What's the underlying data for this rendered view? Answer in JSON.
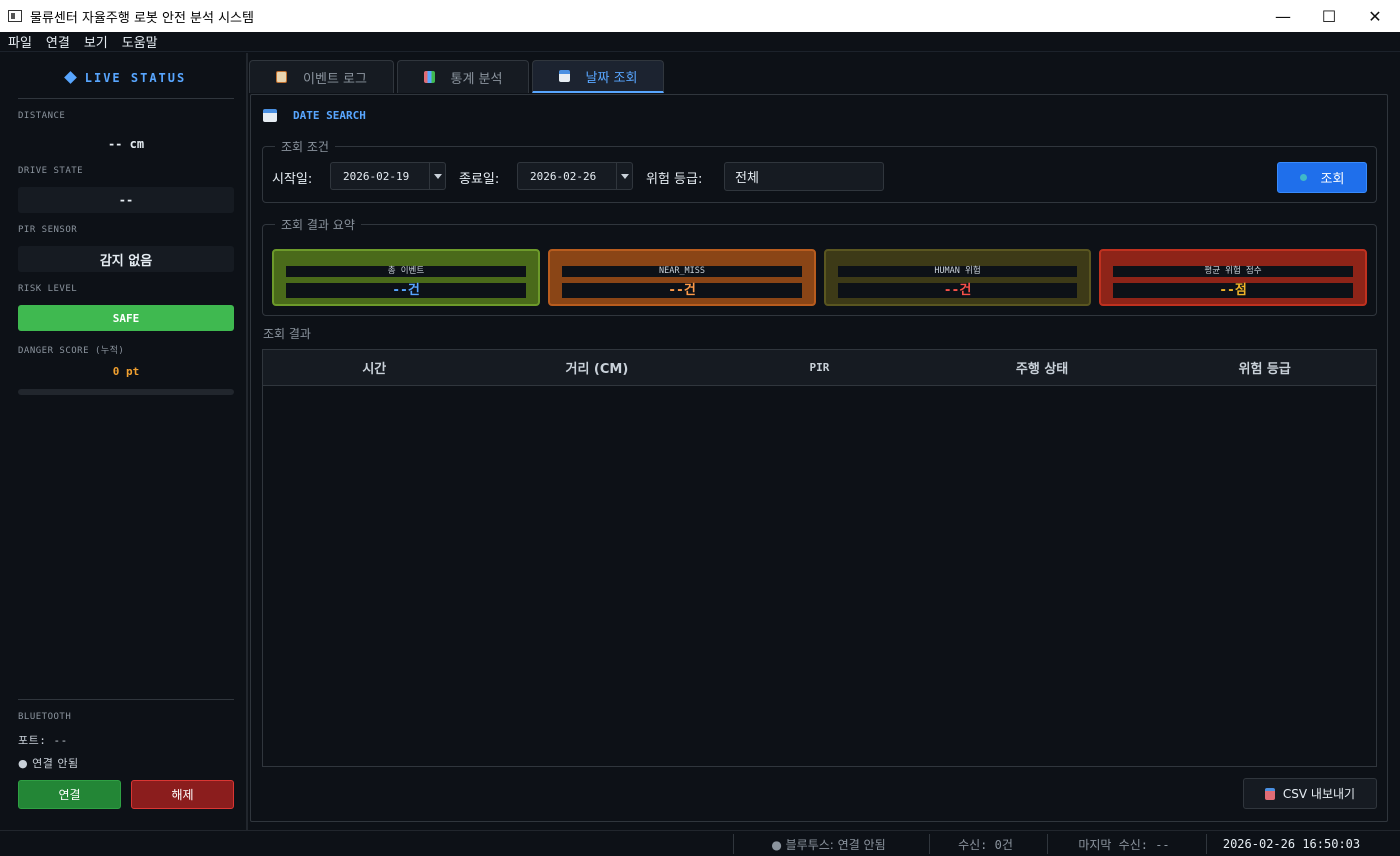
{
  "window": {
    "title": "물류센터 자율주행 로봇 안전 분석 시스템",
    "controls": {
      "minimize": "—",
      "maximize": "☐",
      "close": "✕"
    }
  },
  "menu": [
    "파일",
    "연결",
    "보기",
    "도움말"
  ],
  "left_panel": {
    "title": "LIVE STATUS",
    "distance_label": "DISTANCE",
    "distance_value": "-- cm",
    "drive_state_label": "DRIVE STATE",
    "drive_state_value": "--",
    "pir_label": "PIR SENSOR",
    "pir_value": "감지 없음",
    "risk_label": "RISK LEVEL",
    "risk_value": "SAFE",
    "danger_label": "DANGER SCORE (누적)",
    "danger_value": "0 pt",
    "danger_progress": 0,
    "bluetooth_label": "BLUETOOTH",
    "port_text": "포트: --",
    "conn_text": "● 연결 안됨",
    "connect_button": "연결",
    "disconnect_button": "해제"
  },
  "tabs": [
    {
      "label": "이벤트 로그",
      "icon": "clipboard-icon",
      "active": false
    },
    {
      "label": "통계 분석",
      "icon": "chart-icon",
      "active": false
    },
    {
      "label": "날짜 조회",
      "icon": "calendar-icon",
      "active": true
    }
  ],
  "date_search": {
    "title": "DATE SEARCH",
    "conditions_title": "조회 조건",
    "start_label": "시작일:",
    "start_value": "2026-02-19",
    "end_label": "종료일:",
    "end_value": "2026-02-26",
    "risk_label": "위험 등급:",
    "risk_value": "전체",
    "search_button": "조회",
    "summary_title": "조회 결과 요약",
    "cards": [
      {
        "label": "총 이벤트",
        "value": "--건",
        "bg": "#4a6a1a",
        "border": "#6d9a2a",
        "color": "#58a6ff"
      },
      {
        "label": "NEAR_MISS",
        "value": "--건",
        "bg": "#8a4516",
        "border": "#b85c1e",
        "color": "#ff9b4a"
      },
      {
        "label": "HUMAN 위험",
        "value": "--건",
        "bg": "#3d3a17",
        "border": "#5a5620",
        "color": "#f85149"
      },
      {
        "label": "평균 위험 점수",
        "value": "--점",
        "bg": "#8e2418",
        "border": "#c0311f",
        "color": "#f0b429"
      }
    ],
    "results_label": "조회 결과",
    "columns": [
      "시간",
      "거리 (CM)",
      "PIR",
      "주행 상태",
      "위험 등급"
    ],
    "rows": [],
    "csv_button": "CSV 내보내기"
  },
  "status_bar": {
    "bluetooth": "● 블루투스: 연결 안됨",
    "received": "수신: 0건",
    "last_received": "마지막 수신: --",
    "datetime": "2026-02-26  16:50:03"
  },
  "colors": {
    "accent": "#58a6ff",
    "safe": "#3fb950",
    "connect": "#238636",
    "disconnect": "#8b1d1d",
    "search": "#1f6feb",
    "danger_score": "#f0a030"
  }
}
